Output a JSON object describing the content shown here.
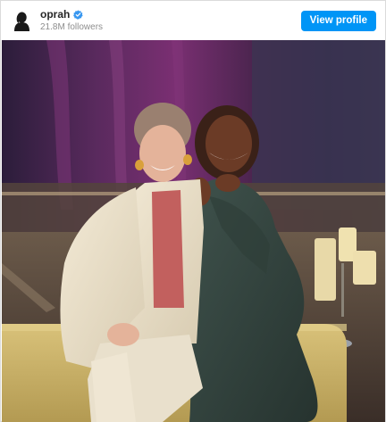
{
  "header": {
    "username": "oprah",
    "followers": "21.8M followers",
    "view_profile_label": "View profile"
  },
  "icons": {
    "avatar": "profile-silhouette-icon",
    "verified": "verified-badge-icon"
  },
  "colors": {
    "accent": "#0095f6",
    "verified_badge": "#3897f0",
    "muted_text": "#8e8e8e"
  }
}
